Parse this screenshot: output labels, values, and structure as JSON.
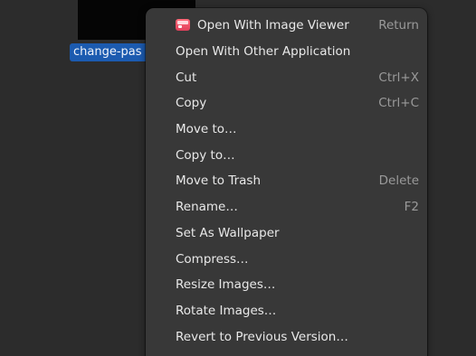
{
  "file": {
    "name": "change-pas"
  },
  "menu": {
    "items": [
      {
        "label": "Open With Image Viewer",
        "accel": "Return",
        "icon": "image-viewer-icon"
      },
      {
        "label": "Open With Other Application",
        "accel": ""
      },
      {
        "label": "Cut",
        "accel": "Ctrl+X"
      },
      {
        "label": "Copy",
        "accel": "Ctrl+C"
      },
      {
        "label": "Move to…",
        "accel": ""
      },
      {
        "label": "Copy to…",
        "accel": ""
      },
      {
        "label": "Move to Trash",
        "accel": "Delete"
      },
      {
        "label": "Rename…",
        "accel": "F2"
      },
      {
        "label": "Set As Wallpaper",
        "accel": ""
      },
      {
        "label": "Compress…",
        "accel": ""
      },
      {
        "label": "Resize Images…",
        "accel": ""
      },
      {
        "label": "Rotate Images…",
        "accel": ""
      },
      {
        "label": "Revert to Previous Version…",
        "accel": ""
      }
    ]
  },
  "colors": {
    "selection": "#1c5bb0",
    "menu_bg": "#383838",
    "desktop_bg": "#2c2c2c"
  }
}
